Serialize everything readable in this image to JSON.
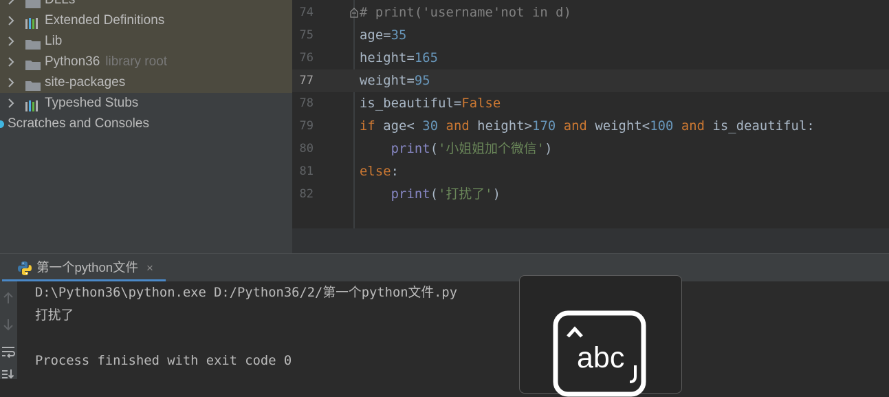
{
  "project_tree": {
    "items": [
      {
        "label": "DLLs",
        "icon": "folder-icon"
      },
      {
        "label": "Extended Definitions",
        "icon": "library-icon"
      },
      {
        "label": "Lib",
        "icon": "folder-icon"
      },
      {
        "label": "Python36",
        "note": "library root",
        "icon": "folder-icon"
      },
      {
        "label": "site-packages",
        "icon": "folder-icon"
      },
      {
        "label": "Typeshed Stubs",
        "icon": "library-icon"
      },
      {
        "label": "Scratches and Consoles",
        "icon": "scratches-icon"
      }
    ]
  },
  "editor": {
    "current_line": "77",
    "lines": [
      {
        "n": "74",
        "text": "# print('username'not in d)"
      },
      {
        "n": "75",
        "text": "age=35"
      },
      {
        "n": "76",
        "text": "height=165"
      },
      {
        "n": "77",
        "text": "weight=95"
      },
      {
        "n": "78",
        "text": "is_beautiful=False"
      },
      {
        "n": "79",
        "text": "if age< 30 and height>170 and weight<100 and is_deautiful:"
      },
      {
        "n": "80",
        "text": "    print('小姐姐加个微信')"
      },
      {
        "n": "81",
        "text": "else:"
      },
      {
        "n": "82",
        "text": "    print('打扰了')"
      }
    ]
  },
  "run_panel": {
    "tab_label": "第一个python文件",
    "close_symbol": "×",
    "console_lines": [
      "D:\\Python36\\python.exe D:/Python36/2/第一个python文件.py",
      "打扰了",
      "",
      "Process finished with exit code 0"
    ],
    "toolbar_icons": [
      "arrow-up-icon",
      "arrow-down-icon",
      "soft-wrap-icon",
      "scroll-to-end-icon"
    ]
  },
  "ime_overlay": {
    "text": "abc"
  },
  "colors": {
    "tree_bg": "#3c3f41",
    "library_highlight": "#4c4a3f",
    "editor_bg": "#2b2b2b",
    "keyword": "#cc7832",
    "number": "#6897bb",
    "string": "#6a8759",
    "builtin": "#8888c6",
    "comment": "#808080",
    "tab_underline": "#4a88c7"
  }
}
